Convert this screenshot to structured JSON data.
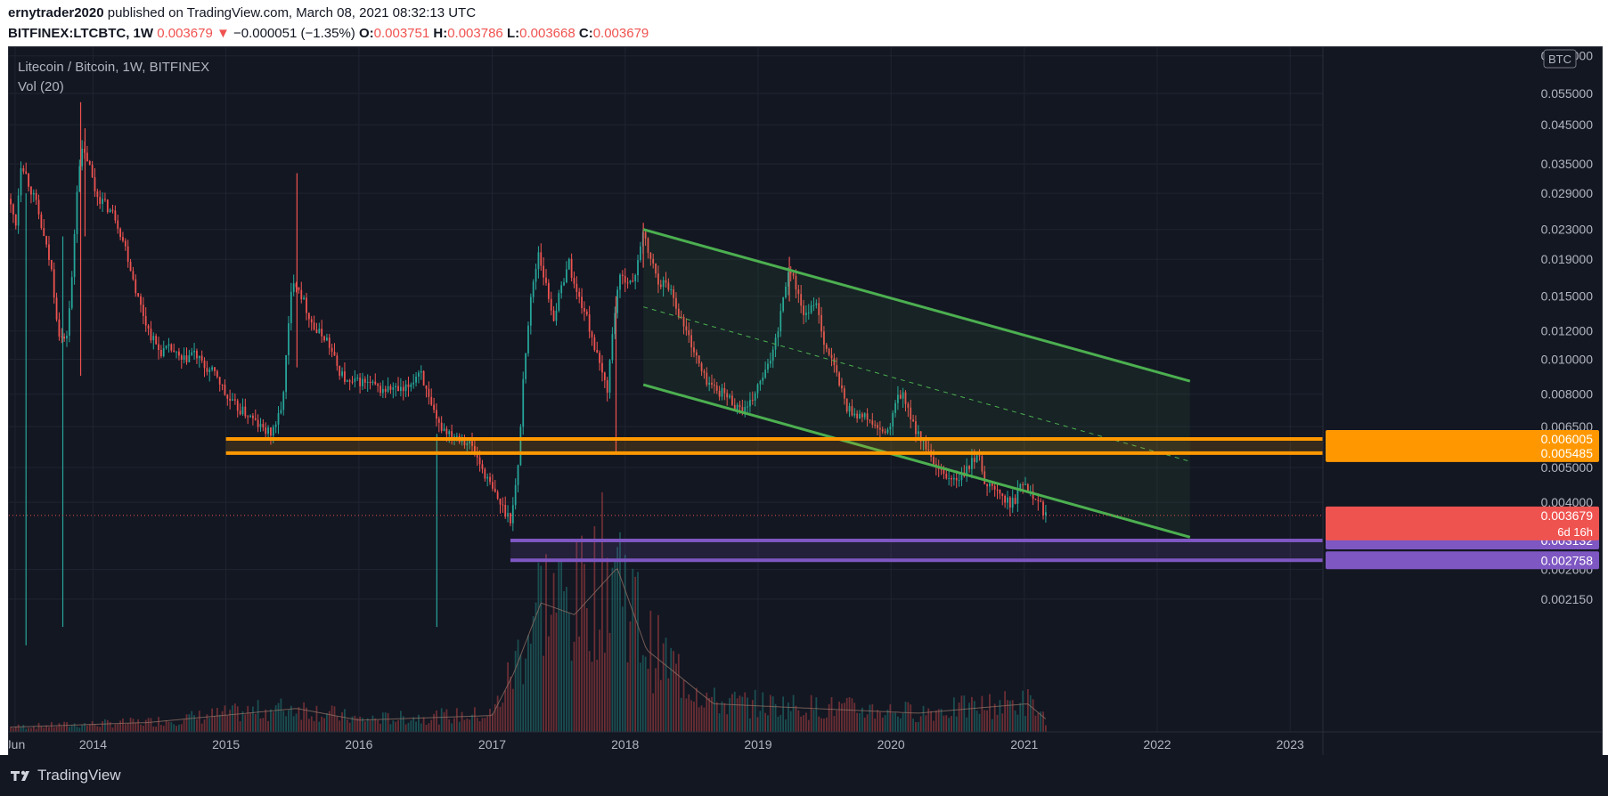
{
  "header": {
    "publisher": "ernytrader2020",
    "published_text": " published on TradingView.com, March 08, 2021 08:32:13 UTC",
    "symbol": "BITFINEX:LTCBTC, 1W",
    "last": "0.003679",
    "change_arrow": "▼",
    "change": "−0.000051 (−1.35%)",
    "o_label": "O:",
    "o_value": "0.003751",
    "h_label": "H:",
    "h_value": "0.003786",
    "l_label": "L:",
    "l_value": "0.003668",
    "c_label": "C:",
    "c_value": "0.003679"
  },
  "legend": {
    "title": "Litecoin / Bitcoin, 1W, BITFINEX",
    "indicator": "Vol (20)"
  },
  "footer": {
    "brand": "TradingView"
  },
  "colors": {
    "background": "#131722",
    "grid": "#1f2431",
    "up": "#26a69a",
    "down": "#ef5350",
    "channel": "#4caf50",
    "resistance": "#ff9800",
    "support": "#7e57c2",
    "text": "#b2b5be"
  },
  "chart_data": {
    "type": "candlestick",
    "symbol": "BITFINEX:LTCBTC",
    "interval": "1W",
    "scale": "log",
    "grid": true,
    "y_unit": "BTC",
    "x_ticks": [
      "Jun",
      "2014",
      "2015",
      "2016",
      "2017",
      "2018",
      "2019",
      "2020",
      "2021",
      "2022",
      "2023"
    ],
    "x_tick_dates": [
      "2013-06-01",
      "2014-01-01",
      "2015-01-01",
      "2016-01-01",
      "2017-01-01",
      "2018-01-01",
      "2019-01-01",
      "2020-01-01",
      "2021-01-01",
      "2022-01-01",
      "2023-01-01"
    ],
    "x_range": [
      "2013-05-15",
      "2023-04-01"
    ],
    "y_ticks": [
      "0.070000",
      "0.055000",
      "0.045000",
      "0.035000",
      "0.029000",
      "0.023000",
      "0.019000",
      "0.015000",
      "0.012000",
      "0.010000",
      "0.008000",
      "0.006500",
      "0.005000",
      "0.004000",
      "0.002600",
      "0.002150"
    ],
    "y_tick_values": [
      0.07,
      0.055,
      0.045,
      0.035,
      0.029,
      0.023,
      0.019,
      0.015,
      0.012,
      0.01,
      0.008,
      0.0065,
      0.005,
      0.004,
      0.0026,
      0.00215
    ],
    "y_range": [
      0.00176,
      0.074
    ],
    "last_price": {
      "value": 0.003679,
      "label": "0.003679",
      "countdown": "6d 16h"
    },
    "price_path": [
      [
        "2013-05-20",
        0.028
      ],
      [
        "2013-06-10",
        0.024
      ],
      [
        "2013-06-25",
        0.036
      ],
      [
        "2013-07-15",
        0.031
      ],
      [
        "2013-08-05",
        0.027
      ],
      [
        "2013-08-25",
        0.022
      ],
      [
        "2013-09-15",
        0.018
      ],
      [
        "2013-10-05",
        0.012
      ],
      [
        "2013-10-25",
        0.011
      ],
      [
        "2013-11-10",
        0.016
      ],
      [
        "2013-11-25",
        0.03
      ],
      [
        "2013-12-05",
        0.038
      ],
      [
        "2013-12-25",
        0.036
      ],
      [
        "2014-01-15",
        0.029
      ],
      [
        "2014-02-10",
        0.027
      ],
      [
        "2014-03-10",
        0.025
      ],
      [
        "2014-04-10",
        0.02
      ],
      [
        "2014-05-10",
        0.015
      ],
      [
        "2014-06-10",
        0.012
      ],
      [
        "2014-07-10",
        0.0105
      ],
      [
        "2014-08-10",
        0.0107
      ],
      [
        "2014-09-10",
        0.0098
      ],
      [
        "2014-10-10",
        0.0105
      ],
      [
        "2014-11-10",
        0.0095
      ],
      [
        "2014-12-15",
        0.009
      ],
      [
        "2015-01-10",
        0.0078
      ],
      [
        "2015-02-10",
        0.0073
      ],
      [
        "2015-03-10",
        0.007
      ],
      [
        "2015-04-10",
        0.0065
      ],
      [
        "2015-05-10",
        0.0062
      ],
      [
        "2015-06-10",
        0.0072
      ],
      [
        "2015-06-25",
        0.011
      ],
      [
        "2015-07-10",
        0.017
      ],
      [
        "2015-07-25",
        0.016
      ],
      [
        "2015-08-15",
        0.014
      ],
      [
        "2015-09-10",
        0.012
      ],
      [
        "2015-10-10",
        0.0115
      ],
      [
        "2015-11-10",
        0.0095
      ],
      [
        "2015-12-10",
        0.0085
      ],
      [
        "2016-01-10",
        0.0087
      ],
      [
        "2016-02-10",
        0.0085
      ],
      [
        "2016-03-10",
        0.0082
      ],
      [
        "2016-04-10",
        0.0083
      ],
      [
        "2016-05-10",
        0.0081
      ],
      [
        "2016-06-10",
        0.0089
      ],
      [
        "2016-06-25",
        0.0095
      ],
      [
        "2016-07-15",
        0.0078
      ],
      [
        "2016-08-10",
        0.0066
      ],
      [
        "2016-09-10",
        0.0063
      ],
      [
        "2016-10-10",
        0.0061
      ],
      [
        "2016-11-10",
        0.0058
      ],
      [
        "2016-12-10",
        0.005
      ],
      [
        "2017-01-10",
        0.0043
      ],
      [
        "2017-02-10",
        0.0038
      ],
      [
        "2017-03-01",
        0.0036
      ],
      [
        "2017-03-20",
        0.005
      ],
      [
        "2017-04-05",
        0.0095
      ],
      [
        "2017-04-25",
        0.015
      ],
      [
        "2017-05-15",
        0.02
      ],
      [
        "2017-06-05",
        0.016
      ],
      [
        "2017-06-25",
        0.013
      ],
      [
        "2017-07-15",
        0.0155
      ],
      [
        "2017-08-05",
        0.019
      ],
      [
        "2017-08-25",
        0.0155
      ],
      [
        "2017-09-15",
        0.014
      ],
      [
        "2017-10-10",
        0.0115
      ],
      [
        "2017-10-30",
        0.0095
      ],
      [
        "2017-11-20",
        0.0083
      ],
      [
        "2017-12-05",
        0.012
      ],
      [
        "2017-12-20",
        0.0165
      ],
      [
        "2018-01-10",
        0.017
      ],
      [
        "2018-01-30",
        0.016
      ],
      [
        "2018-02-15",
        0.02
      ],
      [
        "2018-02-25",
        0.0225
      ],
      [
        "2018-03-15",
        0.0195
      ],
      [
        "2018-04-10",
        0.0165
      ],
      [
        "2018-05-10",
        0.016
      ],
      [
        "2018-06-10",
        0.013
      ],
      [
        "2018-07-10",
        0.011
      ],
      [
        "2018-08-10",
        0.009
      ],
      [
        "2018-09-10",
        0.0083
      ],
      [
        "2018-10-10",
        0.008
      ],
      [
        "2018-11-10",
        0.0074
      ],
      [
        "2018-12-10",
        0.0072
      ],
      [
        "2019-01-05",
        0.0083
      ],
      [
        "2019-02-05",
        0.0095
      ],
      [
        "2019-03-05",
        0.0125
      ],
      [
        "2019-03-25",
        0.0165
      ],
      [
        "2019-04-10",
        0.018
      ],
      [
        "2019-05-05",
        0.014
      ],
      [
        "2019-05-25",
        0.013
      ],
      [
        "2019-06-15",
        0.015
      ],
      [
        "2019-07-05",
        0.0115
      ],
      [
        "2019-08-05",
        0.0095
      ],
      [
        "2019-09-10",
        0.0073
      ],
      [
        "2019-10-10",
        0.007
      ],
      [
        "2019-11-10",
        0.0068
      ],
      [
        "2019-12-10",
        0.0062
      ],
      [
        "2020-01-05",
        0.0064
      ],
      [
        "2020-01-25",
        0.0078
      ],
      [
        "2020-02-10",
        0.008
      ],
      [
        "2020-03-01",
        0.0068
      ],
      [
        "2020-03-20",
        0.0063
      ],
      [
        "2020-04-10",
        0.0058
      ],
      [
        "2020-05-10",
        0.0049
      ],
      [
        "2020-06-10",
        0.0047
      ],
      [
        "2020-07-10",
        0.0046
      ],
      [
        "2020-08-10",
        0.005
      ],
      [
        "2020-09-01",
        0.0055
      ],
      [
        "2020-09-25",
        0.0045
      ],
      [
        "2020-10-25",
        0.0043
      ],
      [
        "2020-11-20",
        0.004
      ],
      [
        "2020-12-10",
        0.004
      ],
      [
        "2021-01-05",
        0.0046
      ],
      [
        "2021-01-25",
        0.0043
      ],
      [
        "2021-02-15",
        0.0041
      ],
      [
        "2021-03-05",
        0.003679
      ]
    ],
    "wicks": [
      [
        "2013-07-01",
        0.0016,
        0.029
      ],
      [
        "2013-10-10",
        0.0018,
        0.022
      ],
      [
        "2013-11-28",
        0.009,
        0.052
      ],
      [
        "2013-12-10",
        0.022,
        0.044
      ],
      [
        "2015-07-15",
        0.0095,
        0.033
      ],
      [
        "2016-08-02",
        0.0018,
        0.0062
      ],
      [
        "2017-12-07",
        0.0055,
        0.015
      ],
      [
        "2018-02-20",
        0.018,
        0.024
      ],
      [
        "2019-03-28",
        0.0145,
        0.0193
      ]
    ],
    "volume_path": [
      [
        "2013-05-20",
        0.02
      ],
      [
        "2014-06-01",
        0.04
      ],
      [
        "2015-07-15",
        0.1
      ],
      [
        "2016-01-01",
        0.05
      ],
      [
        "2017-01-01",
        0.07
      ],
      [
        "2017-03-01",
        0.25
      ],
      [
        "2017-05-15",
        0.55
      ],
      [
        "2017-08-15",
        0.5
      ],
      [
        "2017-12-10",
        0.7
      ],
      [
        "2018-03-01",
        0.35
      ],
      [
        "2018-09-01",
        0.12
      ],
      [
        "2019-06-01",
        0.1
      ],
      [
        "2020-03-15",
        0.08
      ],
      [
        "2021-01-10",
        0.12
      ],
      [
        "2021-03-05",
        0.05
      ]
    ],
    "overlays": {
      "descending_channel": {
        "upper": [
          [
            "2018-02-20",
            0.023
          ],
          [
            "2022-04-01",
            0.0087
          ]
        ],
        "lower": [
          [
            "2018-02-20",
            0.0085
          ],
          [
            "2022-04-01",
            0.0032
          ]
        ],
        "mid": [
          [
            "2018-02-20",
            0.014
          ],
          [
            "2022-04-01",
            0.0052
          ]
        ]
      },
      "resistance_zone": {
        "from": "2015-01-01",
        "upper": 0.006005,
        "lower": 0.005485,
        "labels": [
          "0.006005",
          "0.005485"
        ]
      },
      "support_zone": {
        "from": "2017-02-20",
        "upper": 0.003132,
        "lower": 0.002758,
        "labels": [
          "0.003132",
          "0.002758"
        ]
      }
    }
  }
}
